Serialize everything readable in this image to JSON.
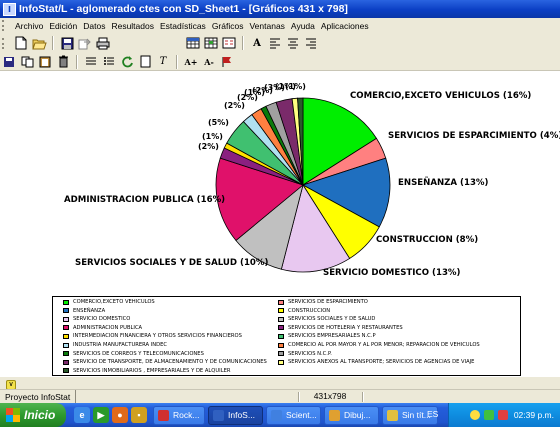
{
  "window": {
    "title": "InfoStat/L - aglomerado ctes con SD_Sheet1 - [Gráficos 431 x 798]",
    "app_icon_label": "I"
  },
  "menu": [
    "Archivo",
    "Edición",
    "Datos",
    "Resultados",
    "Estadísticas",
    "Gráficos",
    "Ventanas",
    "Ayuda",
    "Aplicaciones"
  ],
  "toolbar1": [
    {
      "name": "new-icon"
    },
    {
      "name": "open-icon"
    },
    {
      "name": "save-icon"
    },
    {
      "name": "export-icon"
    },
    {
      "name": "print-icon"
    },
    {
      "name": "table-icon"
    },
    {
      "name": "grid-icon"
    },
    {
      "name": "calculator-icon"
    },
    {
      "name": "font-icon",
      "glyph": "A"
    },
    {
      "name": "align-left-icon"
    },
    {
      "name": "align-center-icon"
    },
    {
      "name": "align-right-icon"
    }
  ],
  "toolbar2": [
    {
      "name": "save-small-icon"
    },
    {
      "name": "copy-icon"
    },
    {
      "name": "clipboard-icon"
    },
    {
      "name": "delete-icon"
    },
    {
      "name": "list-icon"
    },
    {
      "name": "bullets-icon"
    },
    {
      "name": "refresh-icon"
    },
    {
      "name": "page-icon"
    },
    {
      "name": "text-icon",
      "glyph": "T"
    },
    {
      "name": "font-grow-icon",
      "glyph": "A+"
    },
    {
      "name": "font-shrink-icon",
      "glyph": "A-"
    },
    {
      "name": "flag-icon"
    }
  ],
  "chart_data": {
    "type": "pie",
    "title": "",
    "slices": [
      {
        "label": "COMERCIO,EXCETO VEHICULOS (16%)",
        "legend": "COMERCIO,EXCETO VEHICULOS",
        "value": 16,
        "color": "#00ee00"
      },
      {
        "label": "SERVICIOS DE ESPARCIMIENTO (4%)",
        "legend": "SERVICIOS DE ESPARCIMIENTO",
        "value": 4,
        "color": "#ff8080"
      },
      {
        "label": "ENSEÑANZA (13%)",
        "legend": "ENSEÑANZA",
        "value": 13,
        "color": "#1f6fbf"
      },
      {
        "label": "CONSTRUCCION (8%)",
        "legend": "CONSTRUCCION",
        "value": 8,
        "color": "#ffff00"
      },
      {
        "label": "SERVICIO DOMESTICO (13%)",
        "legend": "SERVICIO DOMESTICO",
        "value": 13,
        "color": "#e8c8f0"
      },
      {
        "label": "SERVICIOS SOCIALES Y DE SALUD (10%)",
        "legend": "SERVICIOS SOCIALES Y DE SALUD",
        "value": 10,
        "color": "#c0c0c0"
      },
      {
        "label": "ADMINISTRACION PUBLICA (16%)",
        "legend": "ADMINISTRACION PUBLICA",
        "value": 16,
        "color": "#e0116a"
      },
      {
        "label": "(2%)",
        "legend": "SERVICIOS DE HOTELERIA Y RESTAURANTES",
        "value": 2,
        "color": "#8a2080"
      },
      {
        "label": "(1%)",
        "legend": "INTERMEDIACION FINANCIERA Y OTROS SERVICIOS FINANCIEROS",
        "value": 1,
        "color": "#ffe000"
      },
      {
        "label": "(5%)",
        "legend": "SERVICIOS EMPRESARIALES N.C.P",
        "value": 5,
        "color": "#40c070"
      },
      {
        "label": "(2%)",
        "legend": "INDUSTRIA MANUFACTURERA INDEC",
        "value": 2,
        "color": "#b0e0f0"
      },
      {
        "label": "(2%)",
        "legend": "COMERCIO AL POR MAYOR Y AL POR MENOR; REPARACION DE VEHICULOS",
        "value": 2,
        "color": "#ff8040"
      },
      {
        "label": "(1%)",
        "legend": "SERVICIOS DE CORREOS Y TELECOMUNICACIONES",
        "value": 1,
        "color": "#0a7a0a"
      },
      {
        "label": "(2%)",
        "legend": "SERVICIOS N.C.P.",
        "value": 2,
        "color": "#a0a0a0"
      },
      {
        "label": "(3%)",
        "legend": "SERVICIO DE TRANSPORTE, DE ALMACENAMIENTO Y DE COMUNICACIONES",
        "value": 3,
        "color": "#7a2a6a"
      },
      {
        "label": "(1%)",
        "legend": "SERVICIOS ANEXOS AL TRANSPORTE; SERVICIOS DE AGENCIAS DE VIAJE",
        "value": 1,
        "color": "#ffff80"
      },
      {
        "label": "(1%)",
        "legend": "SERVICIOS INMOBILIARIOS , EMPRESARIALES Y DE ALQUILER",
        "value": 1,
        "color": "#2a5a2a"
      }
    ],
    "legend_position": "bottom",
    "legend_layout": [
      [
        "COMERCIO,EXCETO VEHICULOS",
        "SERVICIOS DE ESPARCIMIENTO"
      ],
      [
        "ENSEÑANZA",
        "CONSTRUCCION"
      ],
      [
        "SERVICIO DOMESTICO",
        "SERVICIOS SOCIALES Y DE SALUD"
      ],
      [
        "ADMINISTRACION PUBLICA",
        "SERVICIOS DE HOTELERIA Y RESTAURANTES"
      ],
      [
        "INTERMEDIACION FINANCIERA Y OTROS SERVICIOS FINANCIEROS",
        "SERVICIOS EMPRESARIALES N.C.P"
      ],
      [
        "INDUSTRIA MANUFACTURERA INDEC",
        "COMERCIO AL POR MAYOR Y AL POR MENOR; REPARACION DE VEHICULOS"
      ],
      [
        "SERVICIOS DE CORREOS Y TELECOMUNICACIONES",
        "SERVICIOS N.C.P."
      ],
      [
        "SERVICIO DE TRANSPORTE, DE ALMACENAMIENTO Y DE COMUNICACIONES",
        "SERVICIOS ANEXOS AL TRANSPORTE; SERVICIOS DE AGENCIAS DE VIAJE"
      ],
      [
        "SERVICIOS INMOBILIARIOS , EMPRESARIALES Y DE ALQUILER",
        ""
      ]
    ]
  },
  "statusbar": {
    "project_tab": "Proyecto InfoStat",
    "dimensions": "431x798"
  },
  "taskbar": {
    "start_label": "Inicio",
    "tasks": [
      {
        "label": "Rock...",
        "active": false,
        "icon_color": "#d03030"
      },
      {
        "label": "InfoS...",
        "active": true,
        "icon_color": "#3060c0"
      },
      {
        "label": "Scient...",
        "active": false,
        "icon_color": "#4080e0"
      },
      {
        "label": "Dibuj...",
        "active": false,
        "icon_color": "#e0a030"
      },
      {
        "label": "Sin tít...",
        "active": false,
        "icon_color": "#e0c040"
      }
    ],
    "language": "ES",
    "clock": "02:39 p.m."
  }
}
